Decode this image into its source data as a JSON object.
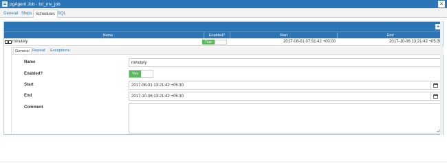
{
  "window": {
    "title": "pgAgent Job - tst_mv_job",
    "icons": {
      "app": "pgagent-job-icon",
      "close": "close-icon"
    }
  },
  "tabs": [
    {
      "label": "General",
      "active": false
    },
    {
      "label": "Steps",
      "active": false
    },
    {
      "label": "Schedules",
      "active": true
    },
    {
      "label": "SQL",
      "active": false
    }
  ],
  "grid": {
    "add_icon": "plus-icon",
    "columns": [
      "Name",
      "Enabled?",
      "Start",
      "End"
    ],
    "rows": [
      {
        "name": "minutely",
        "enabled": "True",
        "start": "2017-08-01 07:51:42 +00:00",
        "end": "2017-10-06 13:21:42 +05:30"
      }
    ]
  },
  "subtabs": [
    {
      "label": "General",
      "active": true
    },
    {
      "label": "Repeat",
      "active": false
    },
    {
      "label": "Exceptions",
      "active": false
    }
  ],
  "form": {
    "name_label": "Name",
    "name_value": "minutely",
    "enabled_label": "Enabled?",
    "enabled_value": "Yes",
    "start_label": "Start",
    "start_value": "2017-08-01 13:21:42 +05:30",
    "end_label": "End",
    "end_value": "2017-10-06 13:21:42 +05:30",
    "comment_label": "Comment",
    "comment_value": ""
  },
  "colors": {
    "accent": "#2c76b7",
    "success": "#5cb85c"
  }
}
